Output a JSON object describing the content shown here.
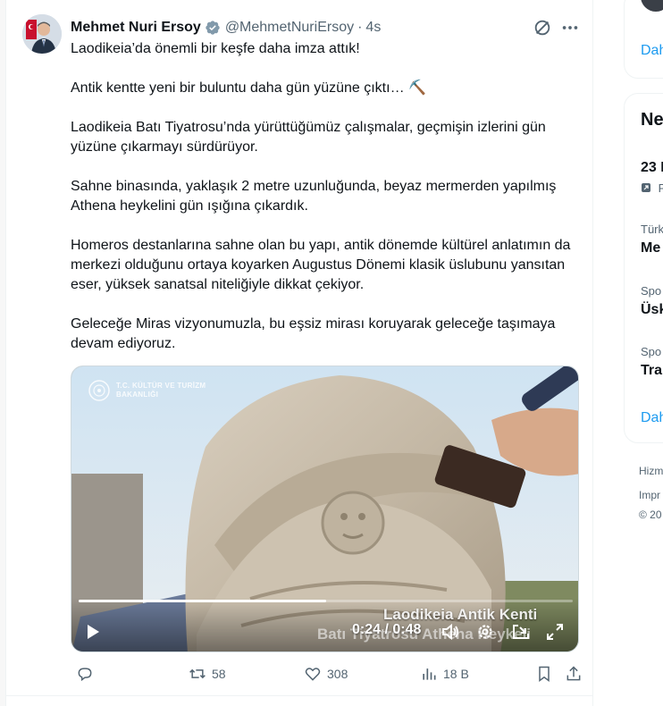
{
  "tweet": {
    "author_name": "Mehmet Nuri Ersoy",
    "author_handle": "@MehmetNuriErsoy",
    "separator": "·",
    "time": "4s",
    "verified_color": "#829aab",
    "paragraphs": [
      "Laodikeia’da önemli bir keşfe daha imza attık!",
      "Antik kentte yeni bir buluntu daha gün yüzüne çıktı… ⛏️",
      "Laodikeia Batı Tiyatrosu’nda yürüttüğümüz çalışmalar, geçmişin izlerini gün yüzüne çıkarmayı sürdürüyor.",
      "Sahne binasında, yaklaşık 2 metre uzunluğunda, beyaz mermerden yapılmış Athena heykelini gün ışığına çıkardık.",
      "Homeros destanlarına sahne olan bu yapı, antik dönemde kültürel anlatımın da merkezi olduğunu ortaya koyarken Augustus Dönemi klasik üslubunu yansıtan eser, yüksek sanatsal niteliğiyle dikkat çekiyor.",
      "Geleceğe Miras vizyonumuzla, bu eşsiz mirası koruyarak geleceğe taşımaya devam ediyoruz."
    ],
    "video": {
      "watermark_line1": "T.C. KÜLTÜR VE TURİZM",
      "watermark_line2": "BAKANLIĞI",
      "caption_title": "Laodikeia Antik Kenti",
      "caption_sub": "Batı Tiyatrosu Athena Heykeli",
      "current_time": "0:24",
      "duration": "0:48",
      "time_display": "0:24 / 0:48",
      "progress": 0.5
    },
    "actions": {
      "reply_count": "",
      "retweet_count": "58",
      "like_count": "308",
      "views_count": "18 B"
    }
  },
  "sidebar": {
    "show_more_1": "Dah",
    "section_title": "Ne",
    "item_date": "23 I",
    "item_sub": "F",
    "trend1_context": "Türk",
    "trend1_name": "Me",
    "trend2_context": "Spo",
    "trend2_name": "Üsk",
    "trend3_context": "Spo",
    "trend3_name": "Tra",
    "show_more_2": "Dah",
    "footer1": "Hizm",
    "footer2": "Impr",
    "footer3": "© 20"
  },
  "colors": {
    "text": "#0f1419",
    "muted": "#536471",
    "link": "#1d9bf0",
    "border": "#eff3f4"
  }
}
